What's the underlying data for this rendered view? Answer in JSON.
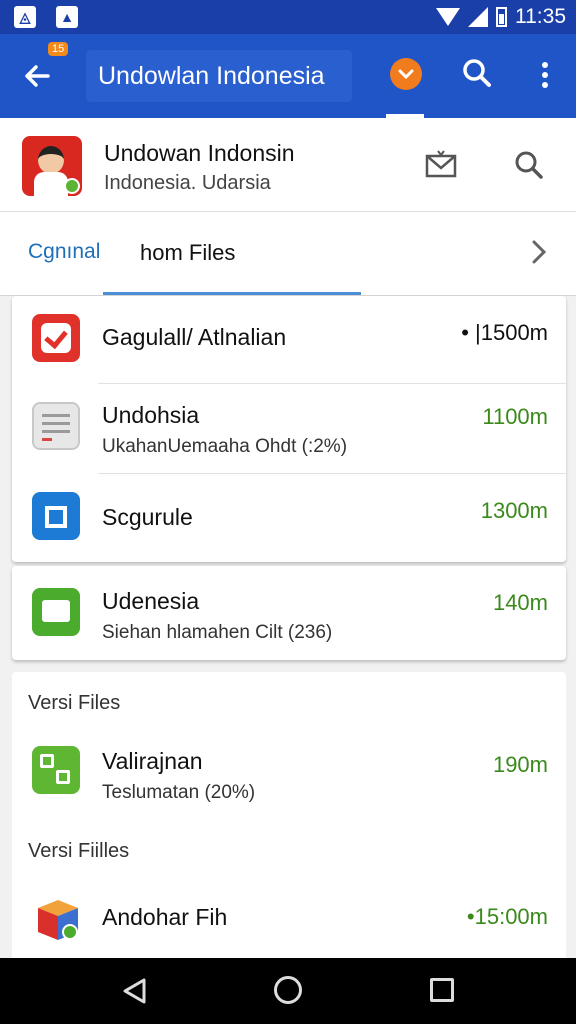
{
  "status_bar": {
    "time": "11:35"
  },
  "app_bar": {
    "badge": "15",
    "search_value": "Undowlan Indonesia"
  },
  "app_header": {
    "title": "Undowan Indonsin",
    "subtitle": "Indonesia. Udarsia"
  },
  "tabs": {
    "left": "Cgnınal",
    "active": "hom Files"
  },
  "items": [
    {
      "title": "Gagulall/ Atlnalian",
      "subtitle": "",
      "size": "• |1500m",
      "icon": "checkmark-icon",
      "color": "#e0322a"
    },
    {
      "title": "Undohsia",
      "subtitle": "UkahanUemaaha Ohdt (:2%)",
      "size": "1100m",
      "icon": "document-icon",
      "color": "#3a8a1b"
    },
    {
      "title": "Scgurule",
      "subtitle": "",
      "size": "1300m",
      "icon": "store-icon",
      "color": "#3a8a1b"
    },
    {
      "title": "Udenesia",
      "subtitle": "Siehan hlamahen Cilt (236)",
      "size": "140m",
      "icon": "mail-icon",
      "color": "#3a8a1b"
    }
  ],
  "sections": [
    {
      "label": "Versi Files",
      "item": {
        "title": "Valirajnan",
        "subtitle": "Teslumatan (20%)",
        "size": "190m",
        "icon": "grid-app-icon"
      }
    },
    {
      "label": "Versi Fiilles",
      "item": {
        "title": "Andohar Fih",
        "subtitle": "",
        "size": "•15:00m",
        "icon": "cube-icon"
      }
    }
  ],
  "colors": {
    "primary": "#1f55c6",
    "status_bar": "#1a3fa8",
    "accent_orange": "#f07c1e",
    "size_green": "#3a8a1b"
  }
}
